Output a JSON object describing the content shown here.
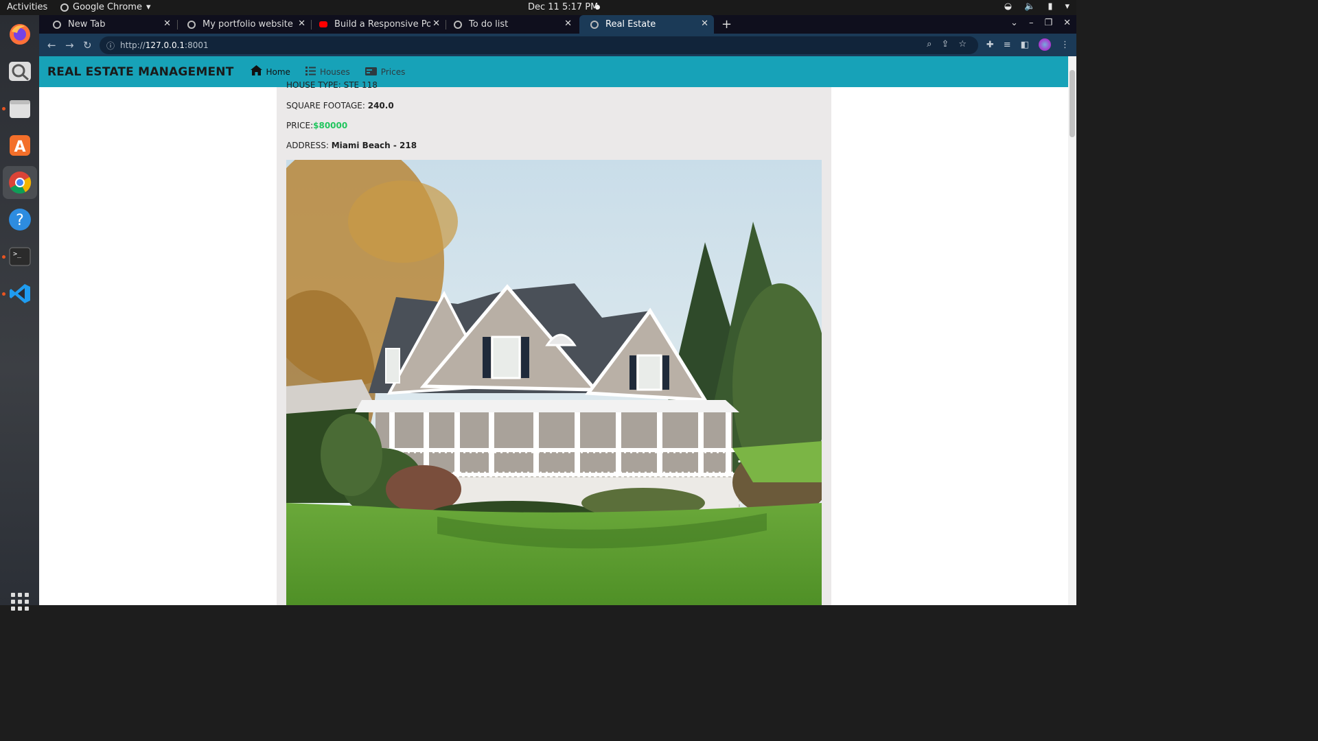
{
  "system": {
    "activities": "Activities",
    "app_name": "Google Chrome",
    "clock": "Dec 11  5:17 PM"
  },
  "browser": {
    "tabs": [
      {
        "label": "New Tab",
        "icon": "globe-icon"
      },
      {
        "label": "My portfolio website",
        "icon": "globe-icon"
      },
      {
        "label": "Build a Responsive Portfo",
        "icon": "youtube-icon"
      },
      {
        "label": "To do list",
        "icon": "globe-icon"
      },
      {
        "label": "Real Estate",
        "icon": "globe-icon",
        "active": true
      }
    ],
    "address": {
      "scheme": "http://",
      "host": "127.0.0.1",
      "port": ":8001"
    }
  },
  "site": {
    "brand": "REAL ESTATE MANAGEMENT",
    "nav": [
      {
        "label": "Home",
        "icon": "home-icon"
      },
      {
        "label": "Houses",
        "icon": "list-icon"
      },
      {
        "label": "Prices",
        "icon": "money-icon"
      }
    ],
    "listing": {
      "clipped_line": "HOUSE TYPE: STE 118",
      "square_footage_label": "SQUARE FOOTAGE:",
      "square_footage_value": "240.0",
      "price_label": "PRICE:",
      "price_value": "$80000",
      "address_label": "ADDRESS:",
      "address_value": "Miami Beach - 218"
    }
  },
  "colors": {
    "navbar": "#17a2b8",
    "price": "#22c55e",
    "card": "#ebe9e9"
  }
}
